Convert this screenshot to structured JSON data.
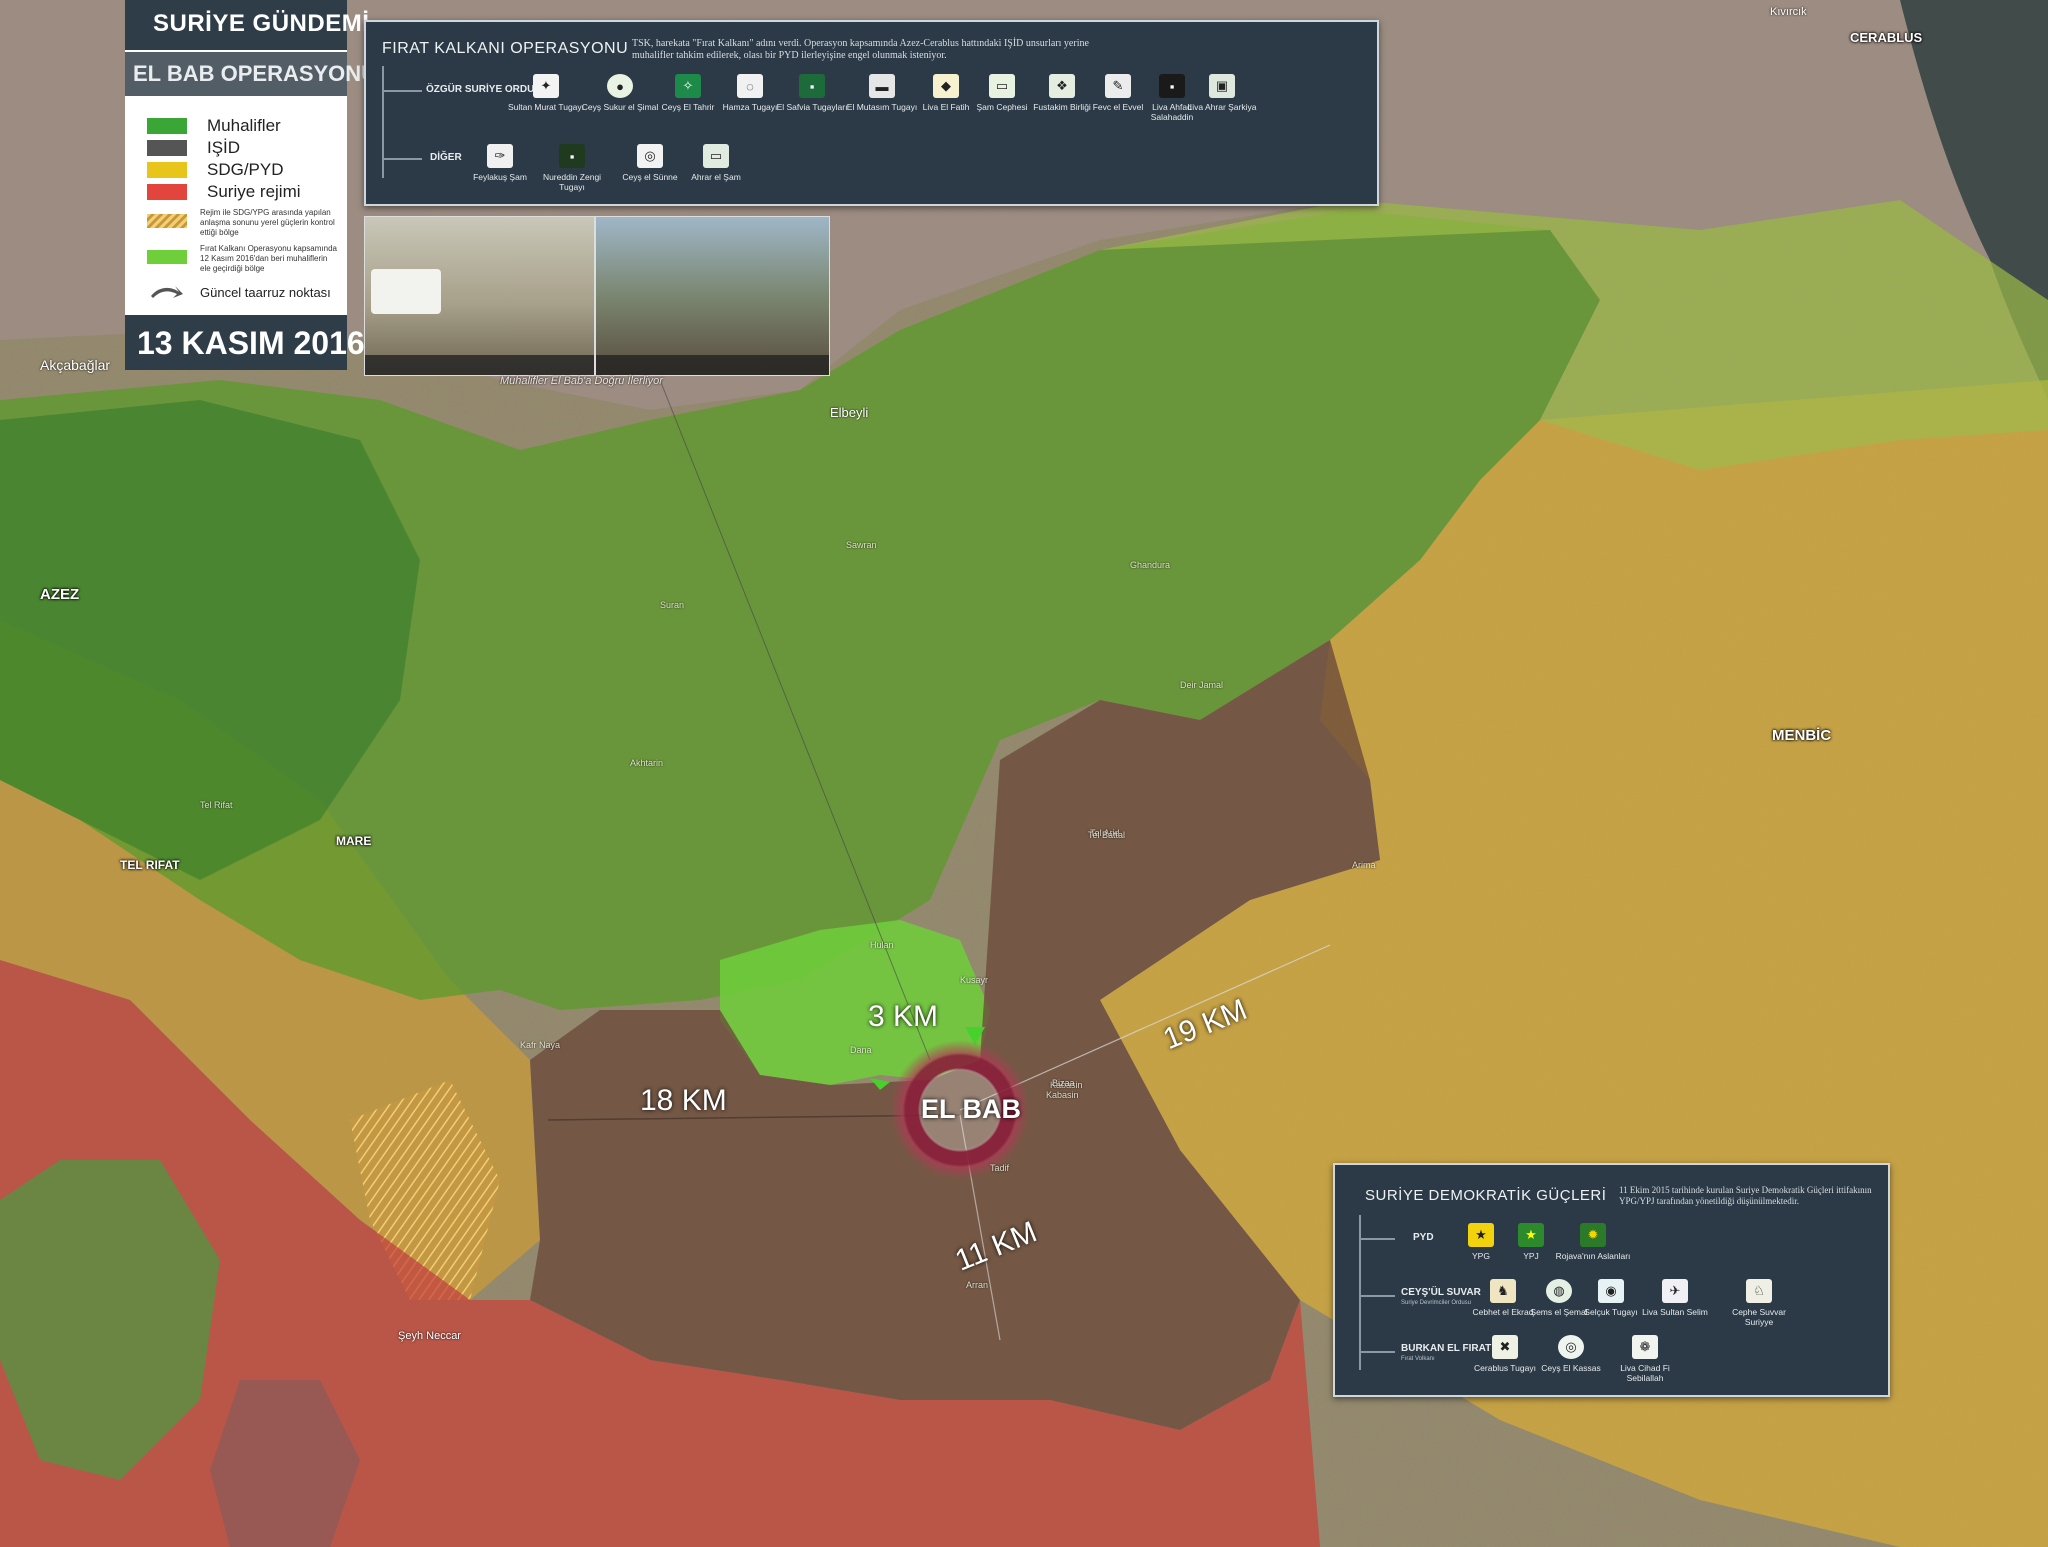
{
  "header": {
    "title_top": "SURİYE GÜNDEMİ",
    "title_sub": "EL BAB OPERASYONU",
    "date": "13 KASIM 2016"
  },
  "legend": {
    "items": [
      {
        "label": "Muhalifler",
        "color": "#3aa635"
      },
      {
        "label": "IŞİD",
        "color": "#555555"
      },
      {
        "label": "SDG/PYD",
        "color": "#e8c51b"
      },
      {
        "label": "Suriye rejimi",
        "color": "#e2453c"
      }
    ],
    "hatch_note": "Rejim ile SDG/YPG arasında yapılan anlaşma sonunu yerel güçlerin kontrol ettiği bölge",
    "green_note": "Fırat Kalkanı Operasyonu kapsamında 12 Kasım 2016'dan beri muhaliflerin ele geçirdiği bölge",
    "arrow_note": "Güncel taarruz noktası"
  },
  "photo_caption": "Muhalifler El Bab'a Doğru İlerliyor",
  "panel_fk": {
    "title": "FIRAT KALKANI OPERASYONU",
    "desc": "TSK, harekata \"Fırat Kalkanı\" adını verdi. Operasyon kapsamında Azez-Cerablus hattındaki IŞİD unsurları yerine muhalifler tahkim edilerek, olası bir PYD ilerleyişine engel olunmak isteniyor.",
    "group1": "ÖZGÜR SURİYE ORDUSU",
    "group1_items": [
      "Sultan Murat Tugayı",
      "Ceyş Sukur el Şimal",
      "Ceyş El Tahrir",
      "Hamza Tugayı",
      "El Safvia Tugayları",
      "El Mutasım Tugayı",
      "Liva El Fatih",
      "Şam Cephesi",
      "Fustakim Birliği",
      "Fevc el Evvel",
      "Liva Ahfad Salahaddin",
      "Liva Ahrar Şarkiya"
    ],
    "group2": "DİĞER",
    "group2_items": [
      "Feylakuş Şam",
      "Nureddin Zengi Tugayı",
      "Ceyş el Sünne",
      "Ahrar el Şam"
    ]
  },
  "panel_sdg": {
    "title": "SURİYE DEMOKRATİK GÜÇLERİ",
    "desc": "11 Ekim 2015 tarihinde kurulan Suriye Demokratik Güçleri ittifakının YPG/YPJ tarafından yönetildiği düşünülmektedir.",
    "group1": "PYD",
    "group1_items": [
      "YPG",
      "YPJ",
      "Rojava'nın Aslanları"
    ],
    "group2": "CEYŞ'ÜL SUVAR",
    "group2_sub": "Suriye Devrimciler Ordusu",
    "group2_items": [
      "Cebhet el Ekrad",
      "Şems el Şemal",
      "Selçuk Tugayı",
      "Liva Sultan Selim",
      "Cephe Suvvar Suriyye"
    ],
    "group3": "BURKAN EL FIRAT",
    "group3_sub": "Fırat Volkanı",
    "group3_items": [
      "Cerablus Tugayı",
      "Ceyş El Kassas",
      "Liva Cihad Fi Sebilallah"
    ]
  },
  "map": {
    "cities": {
      "el_bab": "EL BAB",
      "azez": "AZEZ",
      "mare": "MARE",
      "tel_rifat": "TEL RIFAT",
      "menbic": "MENBİC",
      "cerablus": "CERABLUS",
      "elbeyli": "Elbeyli",
      "akcabaglar": "Akçabağlar",
      "kivircik": "Kıvırcık",
      "seyh_neccar": "Şeyh Neccar"
    },
    "distances": {
      "north": "3 KM",
      "west": "18 KM",
      "east": "19 KM",
      "south": "11 KM"
    },
    "towns": [
      "Dana",
      "Kabasin",
      "Tadif",
      "Arima",
      "Bizaa",
      "Kusayr",
      "Tel Arid",
      "Akhtarin",
      "Suran",
      "Deir Jamal",
      "Tel Rifat",
      "Sawran",
      "Ghandura",
      "Kabasin",
      "Hulan",
      "Tel Battal",
      "Kafr Naya",
      "Arran"
    ]
  },
  "colors": {
    "opposition": "#3aa635",
    "isid": "#555555",
    "sdg": "#e8c51b",
    "regime": "#e2453c",
    "panel_bg": "#2b3a46"
  }
}
